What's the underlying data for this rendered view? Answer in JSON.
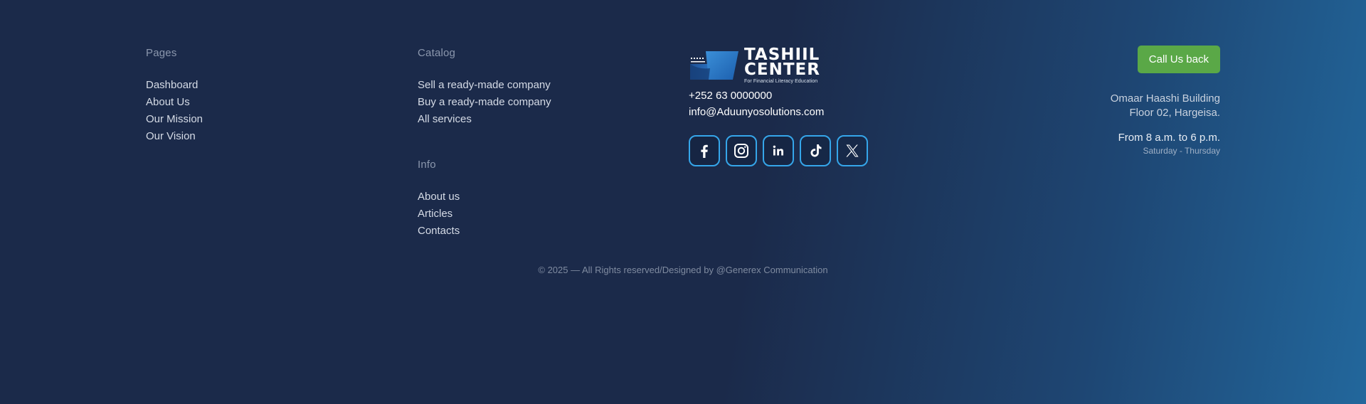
{
  "pages": {
    "heading": "Pages",
    "links": [
      "Dashboard",
      "About Us",
      "Our Mission",
      "Our Vision"
    ]
  },
  "catalog": {
    "heading": "Catalog",
    "links": [
      "Sell a ready-made company",
      "Buy a ready-made company",
      "All services"
    ]
  },
  "info": {
    "heading": "Info",
    "links": [
      "About us",
      "Articles",
      "Contacts"
    ]
  },
  "contact": {
    "logo": {
      "line1": "TASHIIL",
      "line2": "CENTER",
      "tagline": "For Financial Literacy Education"
    },
    "phone": "+252 63 0000000",
    "email": "info@Aduunyosolutions.com",
    "socials": [
      "facebook-icon",
      "instagram-icon",
      "linkedin-icon",
      "tiktok-icon",
      "x-icon"
    ]
  },
  "right": {
    "cta_label": "Call Us back",
    "address_line1": "Omaar Haashi Building",
    "address_line2": "Floor 02, Hargeisa.",
    "hours": "From 8 a.m. to 6 p.m.",
    "days": "Saturday - Thursday"
  },
  "copyright": "© 2025 — All Rights reserved/Designed by @Generex Communication",
  "colors": {
    "background": "#1b2a4a",
    "background_accent": "#22679c",
    "cta": "#5aa847",
    "social_border": "#35a6ea"
  }
}
